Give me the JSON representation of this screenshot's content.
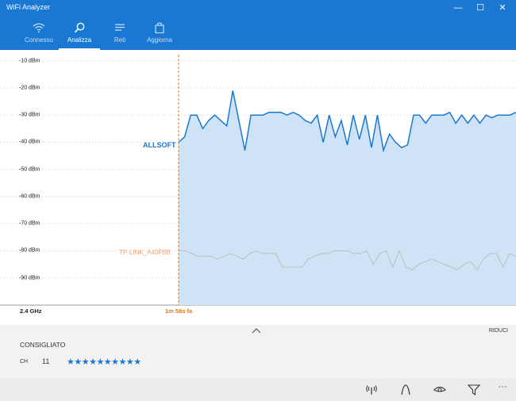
{
  "app": {
    "title": "WiFi Analyzer"
  },
  "window_controls": {
    "minimize": "—",
    "maximize": "☐",
    "close": "✕"
  },
  "nav": [
    {
      "label": "Connesso",
      "icon": "wifi-icon"
    },
    {
      "label": "Analizza",
      "icon": "search-icon",
      "active": true
    },
    {
      "label": "Reti",
      "icon": "list-icon"
    },
    {
      "label": "Aggiorna",
      "icon": "shopping-bag-icon"
    }
  ],
  "chart_data": {
    "type": "area",
    "ylim": [
      -100,
      -6
    ],
    "yticks": [
      "-10 dBm",
      "-20 dBm",
      "-30 dBm",
      "-40 dBm",
      "-50 dBm",
      "-60 dBm",
      "-70 dBm",
      "-80 dBm",
      "-90 dBm"
    ],
    "ytick_values": [
      -10,
      -20,
      -30,
      -40,
      -50,
      -60,
      -70,
      -80,
      -90
    ],
    "band_label": "2.4 GHz",
    "time_marker_label": "1m 58s fa",
    "series": [
      {
        "name": "ALLSOFT",
        "color": "#1a78d3",
        "values": [
          -40,
          -38,
          -30,
          -30,
          -35,
          -32,
          -30,
          -32,
          -34,
          -21,
          -32,
          -43,
          -30,
          -30,
          -30,
          -29,
          -29,
          -29,
          -30,
          -29,
          -30,
          -32,
          -33,
          -30,
          -40,
          -30,
          -38,
          -32,
          -41,
          -30,
          -39,
          -30,
          -42,
          -30,
          -43,
          -37,
          -40,
          -42,
          -41,
          -30,
          -30,
          -33,
          -30,
          -30,
          -30,
          -29,
          -33,
          -30,
          -33,
          -30,
          -33,
          -30,
          -31,
          -30,
          -30,
          -30,
          -29
        ]
      },
      {
        "name": "TP-LINK_A40FBB",
        "color": "#bdbdbd",
        "values": [
          -80,
          -80,
          -81,
          -82,
          -82,
          -82,
          -83,
          -82,
          -81,
          -82,
          -83,
          -81,
          -80,
          -81,
          -81,
          -81,
          -86,
          -86,
          -86,
          -86,
          -83,
          -82,
          -81,
          -81,
          -80,
          -80,
          -80,
          -81,
          -81,
          -80,
          -85,
          -81,
          -80,
          -86,
          -80,
          -86,
          -87,
          -85,
          -84,
          -83,
          -84,
          -85,
          -86,
          -87,
          -85,
          -84,
          -87,
          -83,
          -81,
          -81,
          -86,
          -81,
          -82
        ]
      }
    ]
  },
  "panel": {
    "collapse_label": "RIDUCI",
    "section_title": "CONSIGLIATO",
    "channel_label": "CH",
    "channel_value": "11",
    "rating_stars": 10,
    "rating_text": "★★★★★★★★★★"
  },
  "commands": [
    {
      "icon": "signal-tower-icon"
    },
    {
      "icon": "peak-curve-icon"
    },
    {
      "icon": "eye-icon"
    },
    {
      "icon": "filter-icon"
    },
    {
      "icon": "more-icon",
      "label": "···"
    }
  ]
}
